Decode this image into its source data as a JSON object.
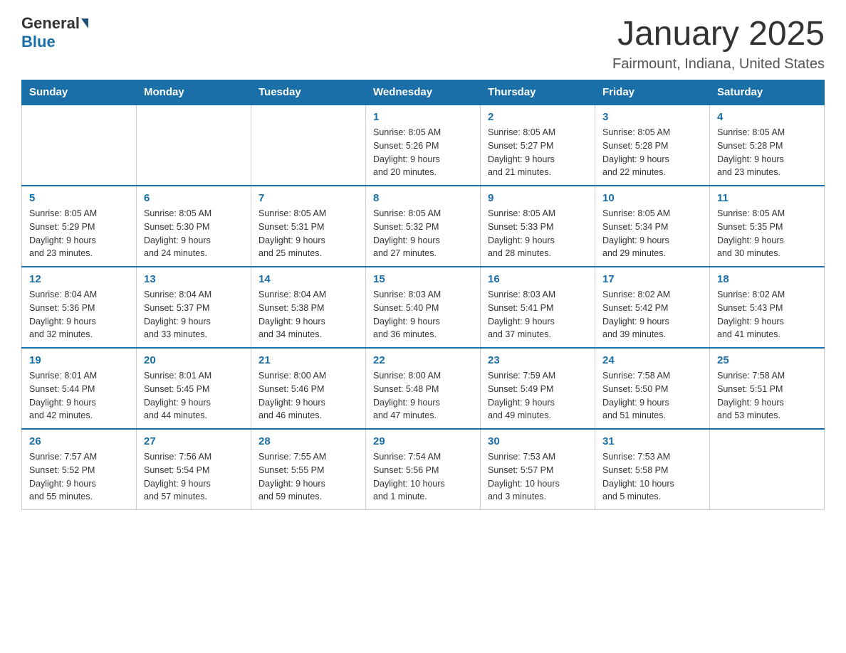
{
  "header": {
    "logo_general": "General",
    "logo_blue": "Blue",
    "month": "January 2025",
    "location": "Fairmount, Indiana, United States"
  },
  "weekdays": [
    "Sunday",
    "Monday",
    "Tuesday",
    "Wednesday",
    "Thursday",
    "Friday",
    "Saturday"
  ],
  "weeks": [
    [
      {
        "day": "",
        "info": ""
      },
      {
        "day": "",
        "info": ""
      },
      {
        "day": "",
        "info": ""
      },
      {
        "day": "1",
        "info": "Sunrise: 8:05 AM\nSunset: 5:26 PM\nDaylight: 9 hours\nand 20 minutes."
      },
      {
        "day": "2",
        "info": "Sunrise: 8:05 AM\nSunset: 5:27 PM\nDaylight: 9 hours\nand 21 minutes."
      },
      {
        "day": "3",
        "info": "Sunrise: 8:05 AM\nSunset: 5:28 PM\nDaylight: 9 hours\nand 22 minutes."
      },
      {
        "day": "4",
        "info": "Sunrise: 8:05 AM\nSunset: 5:28 PM\nDaylight: 9 hours\nand 23 minutes."
      }
    ],
    [
      {
        "day": "5",
        "info": "Sunrise: 8:05 AM\nSunset: 5:29 PM\nDaylight: 9 hours\nand 23 minutes."
      },
      {
        "day": "6",
        "info": "Sunrise: 8:05 AM\nSunset: 5:30 PM\nDaylight: 9 hours\nand 24 minutes."
      },
      {
        "day": "7",
        "info": "Sunrise: 8:05 AM\nSunset: 5:31 PM\nDaylight: 9 hours\nand 25 minutes."
      },
      {
        "day": "8",
        "info": "Sunrise: 8:05 AM\nSunset: 5:32 PM\nDaylight: 9 hours\nand 27 minutes."
      },
      {
        "day": "9",
        "info": "Sunrise: 8:05 AM\nSunset: 5:33 PM\nDaylight: 9 hours\nand 28 minutes."
      },
      {
        "day": "10",
        "info": "Sunrise: 8:05 AM\nSunset: 5:34 PM\nDaylight: 9 hours\nand 29 minutes."
      },
      {
        "day": "11",
        "info": "Sunrise: 8:05 AM\nSunset: 5:35 PM\nDaylight: 9 hours\nand 30 minutes."
      }
    ],
    [
      {
        "day": "12",
        "info": "Sunrise: 8:04 AM\nSunset: 5:36 PM\nDaylight: 9 hours\nand 32 minutes."
      },
      {
        "day": "13",
        "info": "Sunrise: 8:04 AM\nSunset: 5:37 PM\nDaylight: 9 hours\nand 33 minutes."
      },
      {
        "day": "14",
        "info": "Sunrise: 8:04 AM\nSunset: 5:38 PM\nDaylight: 9 hours\nand 34 minutes."
      },
      {
        "day": "15",
        "info": "Sunrise: 8:03 AM\nSunset: 5:40 PM\nDaylight: 9 hours\nand 36 minutes."
      },
      {
        "day": "16",
        "info": "Sunrise: 8:03 AM\nSunset: 5:41 PM\nDaylight: 9 hours\nand 37 minutes."
      },
      {
        "day": "17",
        "info": "Sunrise: 8:02 AM\nSunset: 5:42 PM\nDaylight: 9 hours\nand 39 minutes."
      },
      {
        "day": "18",
        "info": "Sunrise: 8:02 AM\nSunset: 5:43 PM\nDaylight: 9 hours\nand 41 minutes."
      }
    ],
    [
      {
        "day": "19",
        "info": "Sunrise: 8:01 AM\nSunset: 5:44 PM\nDaylight: 9 hours\nand 42 minutes."
      },
      {
        "day": "20",
        "info": "Sunrise: 8:01 AM\nSunset: 5:45 PM\nDaylight: 9 hours\nand 44 minutes."
      },
      {
        "day": "21",
        "info": "Sunrise: 8:00 AM\nSunset: 5:46 PM\nDaylight: 9 hours\nand 46 minutes."
      },
      {
        "day": "22",
        "info": "Sunrise: 8:00 AM\nSunset: 5:48 PM\nDaylight: 9 hours\nand 47 minutes."
      },
      {
        "day": "23",
        "info": "Sunrise: 7:59 AM\nSunset: 5:49 PM\nDaylight: 9 hours\nand 49 minutes."
      },
      {
        "day": "24",
        "info": "Sunrise: 7:58 AM\nSunset: 5:50 PM\nDaylight: 9 hours\nand 51 minutes."
      },
      {
        "day": "25",
        "info": "Sunrise: 7:58 AM\nSunset: 5:51 PM\nDaylight: 9 hours\nand 53 minutes."
      }
    ],
    [
      {
        "day": "26",
        "info": "Sunrise: 7:57 AM\nSunset: 5:52 PM\nDaylight: 9 hours\nand 55 minutes."
      },
      {
        "day": "27",
        "info": "Sunrise: 7:56 AM\nSunset: 5:54 PM\nDaylight: 9 hours\nand 57 minutes."
      },
      {
        "day": "28",
        "info": "Sunrise: 7:55 AM\nSunset: 5:55 PM\nDaylight: 9 hours\nand 59 minutes."
      },
      {
        "day": "29",
        "info": "Sunrise: 7:54 AM\nSunset: 5:56 PM\nDaylight: 10 hours\nand 1 minute."
      },
      {
        "day": "30",
        "info": "Sunrise: 7:53 AM\nSunset: 5:57 PM\nDaylight: 10 hours\nand 3 minutes."
      },
      {
        "day": "31",
        "info": "Sunrise: 7:53 AM\nSunset: 5:58 PM\nDaylight: 10 hours\nand 5 minutes."
      },
      {
        "day": "",
        "info": ""
      }
    ]
  ]
}
